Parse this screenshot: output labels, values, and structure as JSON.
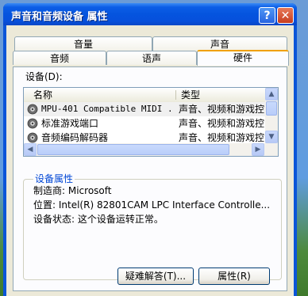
{
  "window": {
    "title": "声音和音频设备 属性",
    "help_label": "?",
    "close_label": "✕"
  },
  "tabs_back": [
    "音量",
    "声音"
  ],
  "tabs_front": [
    "音频",
    "语声",
    "硬件"
  ],
  "devices_label": "设备(D):",
  "list": {
    "columns": [
      "名称",
      "类型"
    ],
    "rows": [
      {
        "name": "MPU-401 Compatible MIDI ...",
        "type": "声音、视频和游戏控",
        "icon": "speaker-icon"
      },
      {
        "name": "标准游戏端口",
        "type": "声音、视频和游戏控",
        "icon": "speaker-icon"
      },
      {
        "name": "音频编码解码器",
        "type": "声音、视频和游戏控",
        "icon": "speaker-icon"
      }
    ]
  },
  "properties": {
    "group_title": "设备属性",
    "manufacturer": "制造商: Microsoft",
    "location": "位置: Intel(R) 82801CAM LPC Interface Controlle...",
    "status": "设备状态: 这个设备运转正常。"
  },
  "buttons": {
    "troubleshoot": "疑难解答(T)...",
    "properties": "属性(R)"
  }
}
